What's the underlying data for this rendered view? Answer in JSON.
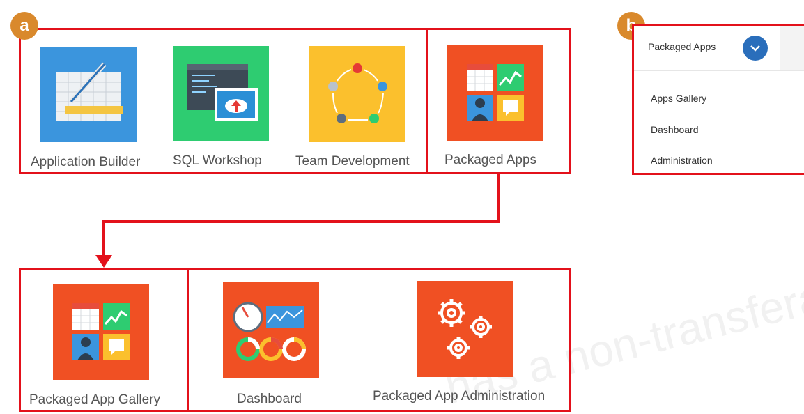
{
  "badges": {
    "a": "a",
    "b": "b"
  },
  "tiles_top": [
    {
      "label": "Application Builder",
      "icon": "application-builder-icon",
      "color": "#3b95dd"
    },
    {
      "label": "SQL Workshop",
      "icon": "sql-workshop-icon",
      "color": "#2ecc71"
    },
    {
      "label": "Team Development",
      "icon": "team-development-icon",
      "color": "#fbc02d"
    },
    {
      "label": "Packaged Apps",
      "icon": "packaged-apps-icon",
      "color": "#f05023"
    }
  ],
  "tiles_bottom": [
    {
      "label": "Packaged App Gallery",
      "icon": "packaged-app-gallery-icon",
      "color": "#f05023"
    },
    {
      "label": "Dashboard",
      "icon": "dashboard-icon",
      "color": "#f05023"
    },
    {
      "label": "Packaged App Administration",
      "icon": "gears-icon",
      "color": "#f05023"
    }
  ],
  "menu": {
    "title": "Packaged Apps",
    "items": [
      "Apps Gallery",
      "Dashboard",
      "Administration"
    ]
  },
  "watermark": "has a non-transferable",
  "colors": {
    "highlight": "#e3111b",
    "badge": "#d9892c",
    "accent": "#f05023",
    "chevron": "#2a6ebb"
  }
}
